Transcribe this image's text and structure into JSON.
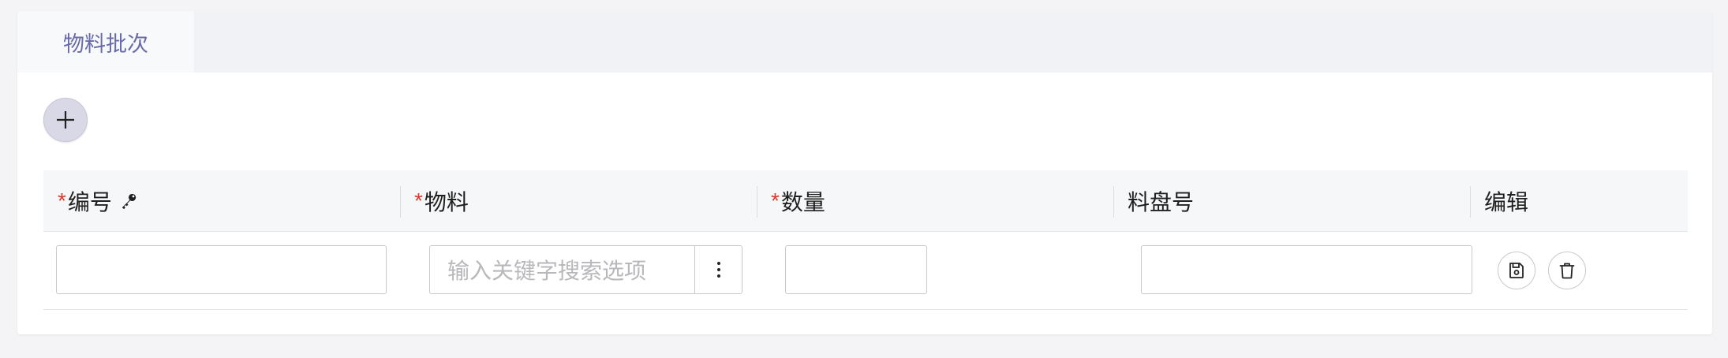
{
  "tabs": [
    {
      "label": "物料批次"
    }
  ],
  "toolbar": {
    "add_icon": "plus-icon"
  },
  "table": {
    "columns": [
      {
        "label": "编号",
        "required": true,
        "icon": "key-icon"
      },
      {
        "label": "物料",
        "required": true
      },
      {
        "label": "数量",
        "required": true
      },
      {
        "label": "料盘号",
        "required": false
      },
      {
        "label": "编辑",
        "required": false
      }
    ],
    "required_mark": "*",
    "row": {
      "code_value": "",
      "material_placeholder": "输入关键字搜索选项",
      "quantity_value": "",
      "reel_value": "",
      "actions": [
        "save-icon",
        "trash-icon"
      ]
    }
  },
  "colors": {
    "accent": "#6b6aa8",
    "required": "#e0382f",
    "add_button_bg": "#d8d8e7"
  }
}
